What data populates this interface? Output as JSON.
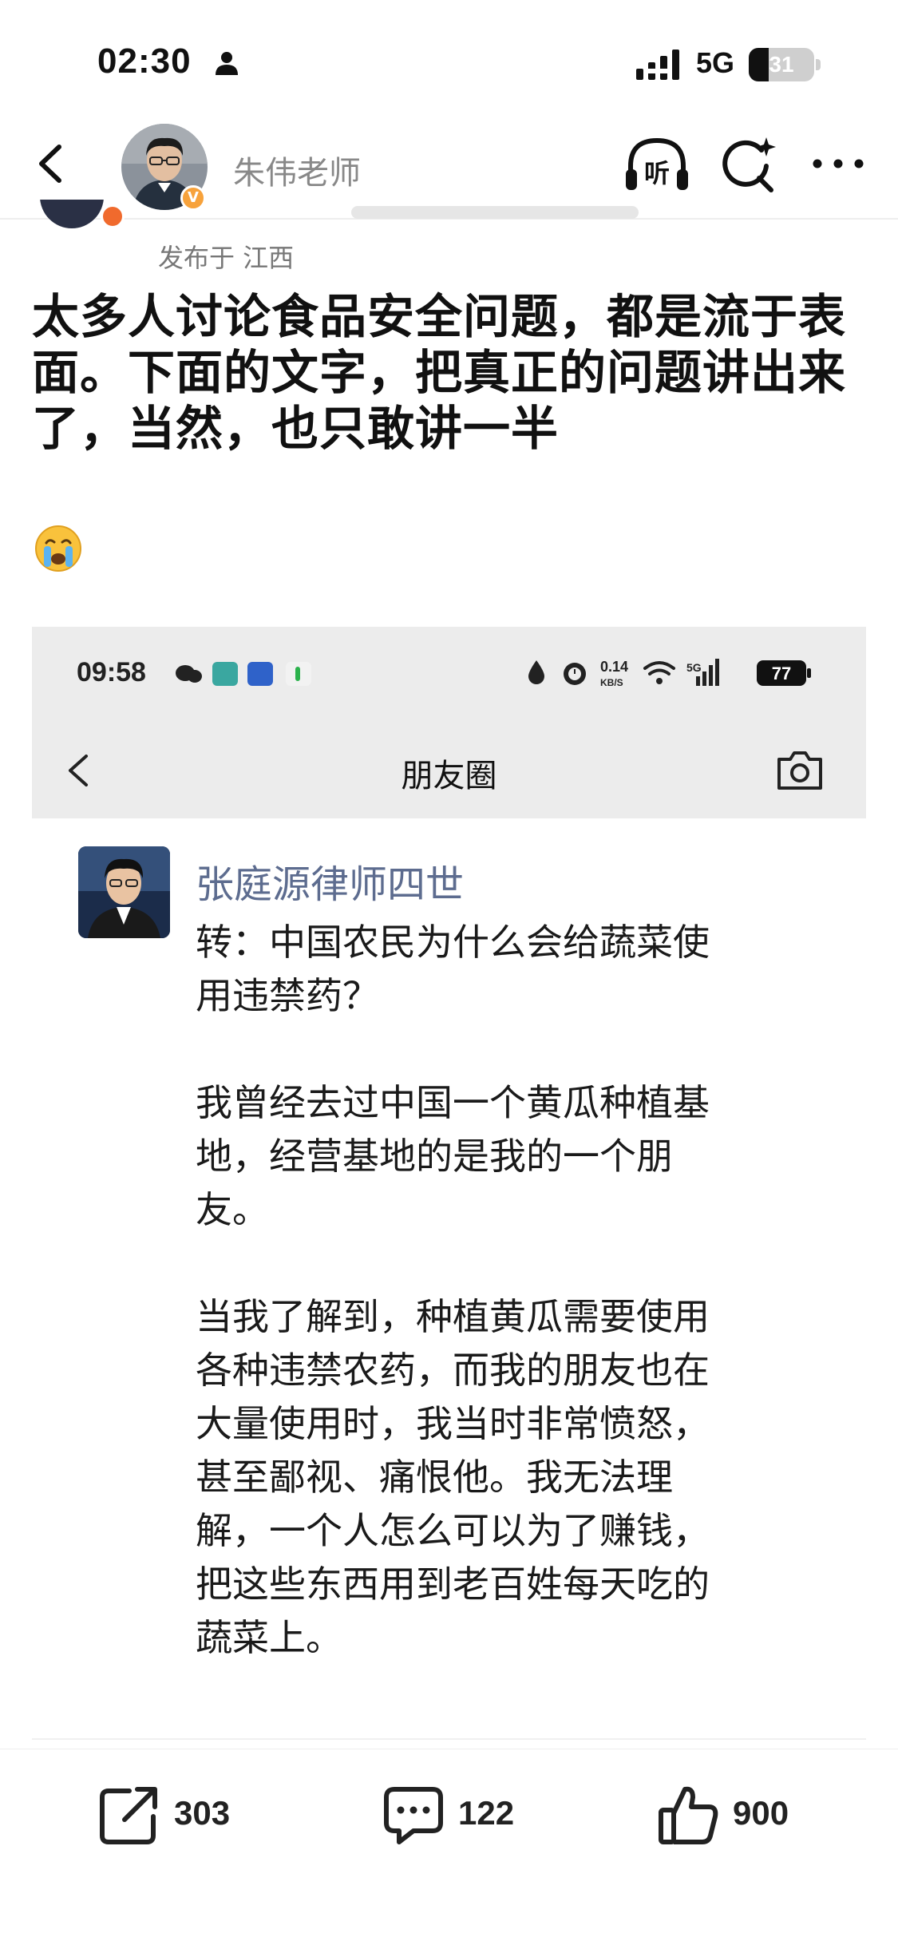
{
  "status_bar": {
    "time": "02:30",
    "network": "5G",
    "battery": "31",
    "battery_level": 0.31
  },
  "header": {
    "author_name": "朱伟老师",
    "back_icon": "chevron-left-icon",
    "listen_label": "听",
    "search_icon": "search-sparkle-icon",
    "more_icon": "more-horizontal-icon"
  },
  "post": {
    "location": "发布于 江西",
    "text": "太多人讨论食品安全问题，都是流于表面。下面的文字，把真正的问题讲出来了，当然，也只敢讲一半",
    "emoji": "crying-face-emoji"
  },
  "screenshot": {
    "status": {
      "time": "09:58",
      "speed": "0.14",
      "speed_unit": "KB/S",
      "network": "5G",
      "battery": "77"
    },
    "nav_title": "朋友圈",
    "moment": {
      "author": "张庭源律师四世",
      "body": "转：中国农民为什么会给蔬菜使\n用违禁药？\n\n我曾经去过中国一个黄瓜种植基\n地，经营基地的是我的一个朋\n友。\n\n当我了解到，种植黄瓜需要使用\n各种违禁农药，而我的朋友也在\n大量使用时，我当时非常愤怒，\n甚至鄙视、痛恨他。我无法理\n解，一个人怎么可以为了赚钱，\n把这些东西用到老百姓每天吃的\n蔬菜上。"
    }
  },
  "actions": {
    "share_count": "303",
    "comment_count": "122",
    "like_count": "900"
  },
  "colors": {
    "author_link": "#5d6c8f",
    "badge_orange": "#f7a23b",
    "muted_text": "#888888"
  }
}
